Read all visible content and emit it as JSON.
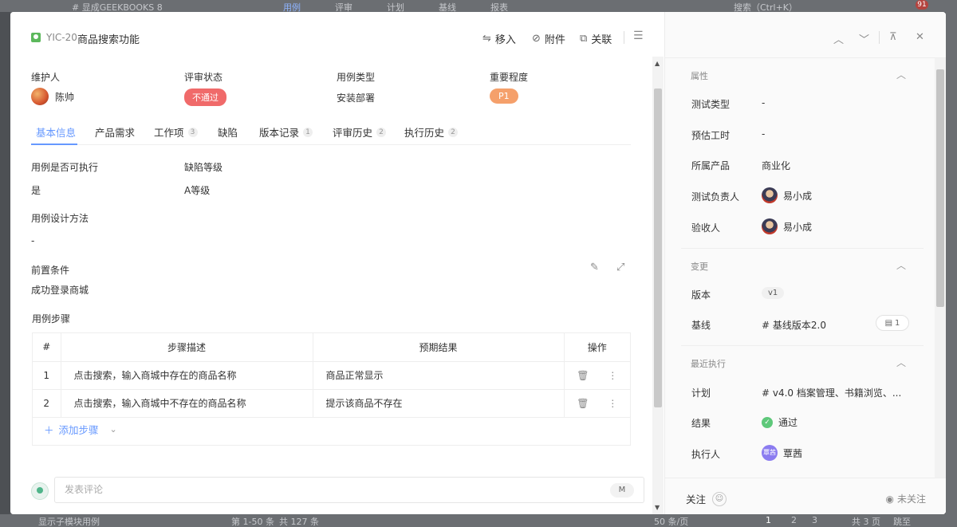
{
  "backdrop": {
    "top_text": "# 显成GEEKBOOKS 8",
    "nav": [
      "用例",
      "评审",
      "计划",
      "基线",
      "报表"
    ],
    "search": "搜索（Ctrl+K）",
    "badge": "91",
    "bottom_left": "显示子模块用例",
    "bottom_range": "第 1-50 条",
    "bottom_total": "共 127 条",
    "per_page": "50 条/页",
    "pages": [
      "1",
      "2",
      "3"
    ],
    "total_pages": "共 3 页",
    "jump": "跳至"
  },
  "header": {
    "work_id": "YIC-20",
    "title": "商品搜索功能",
    "move_label": "移入",
    "attach_label": "附件",
    "link_label": "关联"
  },
  "fields": {
    "maintainer_label": "维护人",
    "maintainer": "陈帅",
    "review_label": "评审状态",
    "review_status": "不通过",
    "type_label": "用例类型",
    "type_value": "安装部署",
    "priority_label": "重要程度",
    "priority_value": "P1"
  },
  "tabs": [
    {
      "label": "基本信息",
      "count": ""
    },
    {
      "label": "产品需求",
      "count": ""
    },
    {
      "label": "工作项",
      "count": "3"
    },
    {
      "label": "缺陷",
      "count": ""
    },
    {
      "label": "版本记录",
      "count": "1"
    },
    {
      "label": "评审历史",
      "count": "2"
    },
    {
      "label": "执行历史",
      "count": "2"
    }
  ],
  "basic": {
    "executable_label": "用例是否可执行",
    "executable_value": "是",
    "defect_level_label": "缺陷等级",
    "defect_level_value": "A等级",
    "design_label": "用例设计方法",
    "design_value": "-",
    "precondition_label": "前置条件",
    "precondition_value": "成功登录商城",
    "steps_label": "用例步骤"
  },
  "steps": {
    "headers": [
      "#",
      "步骤描述",
      "预期结果",
      "操作"
    ],
    "rows": [
      {
        "num": "1",
        "desc": "点击搜索，输入商城中存在的商品名称",
        "expected": "商品正常显示"
      },
      {
        "num": "2",
        "desc": "点击搜索，输入商城中不存在的商品名称",
        "expected": "提示该商品不存在"
      }
    ],
    "add_label": "添加步骤"
  },
  "comment": {
    "placeholder": "发表评论",
    "shortcut": "M"
  },
  "side": {
    "attr_title": "属性",
    "test_type_label": "测试类型",
    "test_type_value": "-",
    "estimate_label": "预估工时",
    "estimate_value": "-",
    "product_label": "所属产品",
    "product_value": "商业化",
    "owner_label": "测试负责人",
    "owner_value": "易小成",
    "acceptor_label": "验收人",
    "acceptor_value": "易小成",
    "change_title": "变更",
    "version_label": "版本",
    "version_value": "v1",
    "baseline_label": "基线",
    "baseline_value": "# 基线版本2.0",
    "baseline_docs": "1",
    "recent_title": "最近执行",
    "plan_label": "计划",
    "plan_value": "# v4.0 档案管理、书籍浏览、...",
    "result_label": "结果",
    "result_value": "通过",
    "executor_label": "执行人",
    "executor_value": "覃茜",
    "executor_avatar": "覃茜",
    "follow_label": "关注",
    "unfollow_label": "未关注"
  },
  "colors": {
    "accent": "#6698ff",
    "danger": "#f06a6a",
    "priority": "#f5a06b",
    "success": "#5ec87a"
  }
}
